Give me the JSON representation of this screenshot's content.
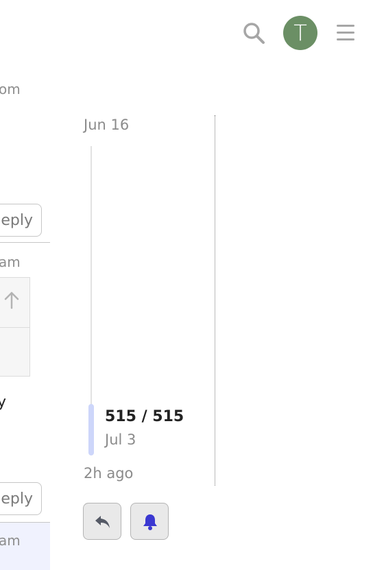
{
  "header": {
    "avatar_letter": "T",
    "avatar_color": "#6b8f65",
    "icons": [
      "search-icon",
      "hamburger-menu-icon"
    ]
  },
  "posts_fragment": {
    "meta_top": "om",
    "reply_label": "eply",
    "meta_mid": "am",
    "body_fragment": "y",
    "reply_label_2": "eply",
    "meta_bottom": "am"
  },
  "timeline": {
    "start_date": "Jun 16",
    "position": "515 / 515",
    "current_date": "Jul 3",
    "last_activity": "2h ago",
    "handle_color": "#cdd6fa"
  },
  "actions": {
    "reply_icon": "reply-icon",
    "notification_icon": "bell-icon",
    "bell_color": "#3b38d1"
  }
}
